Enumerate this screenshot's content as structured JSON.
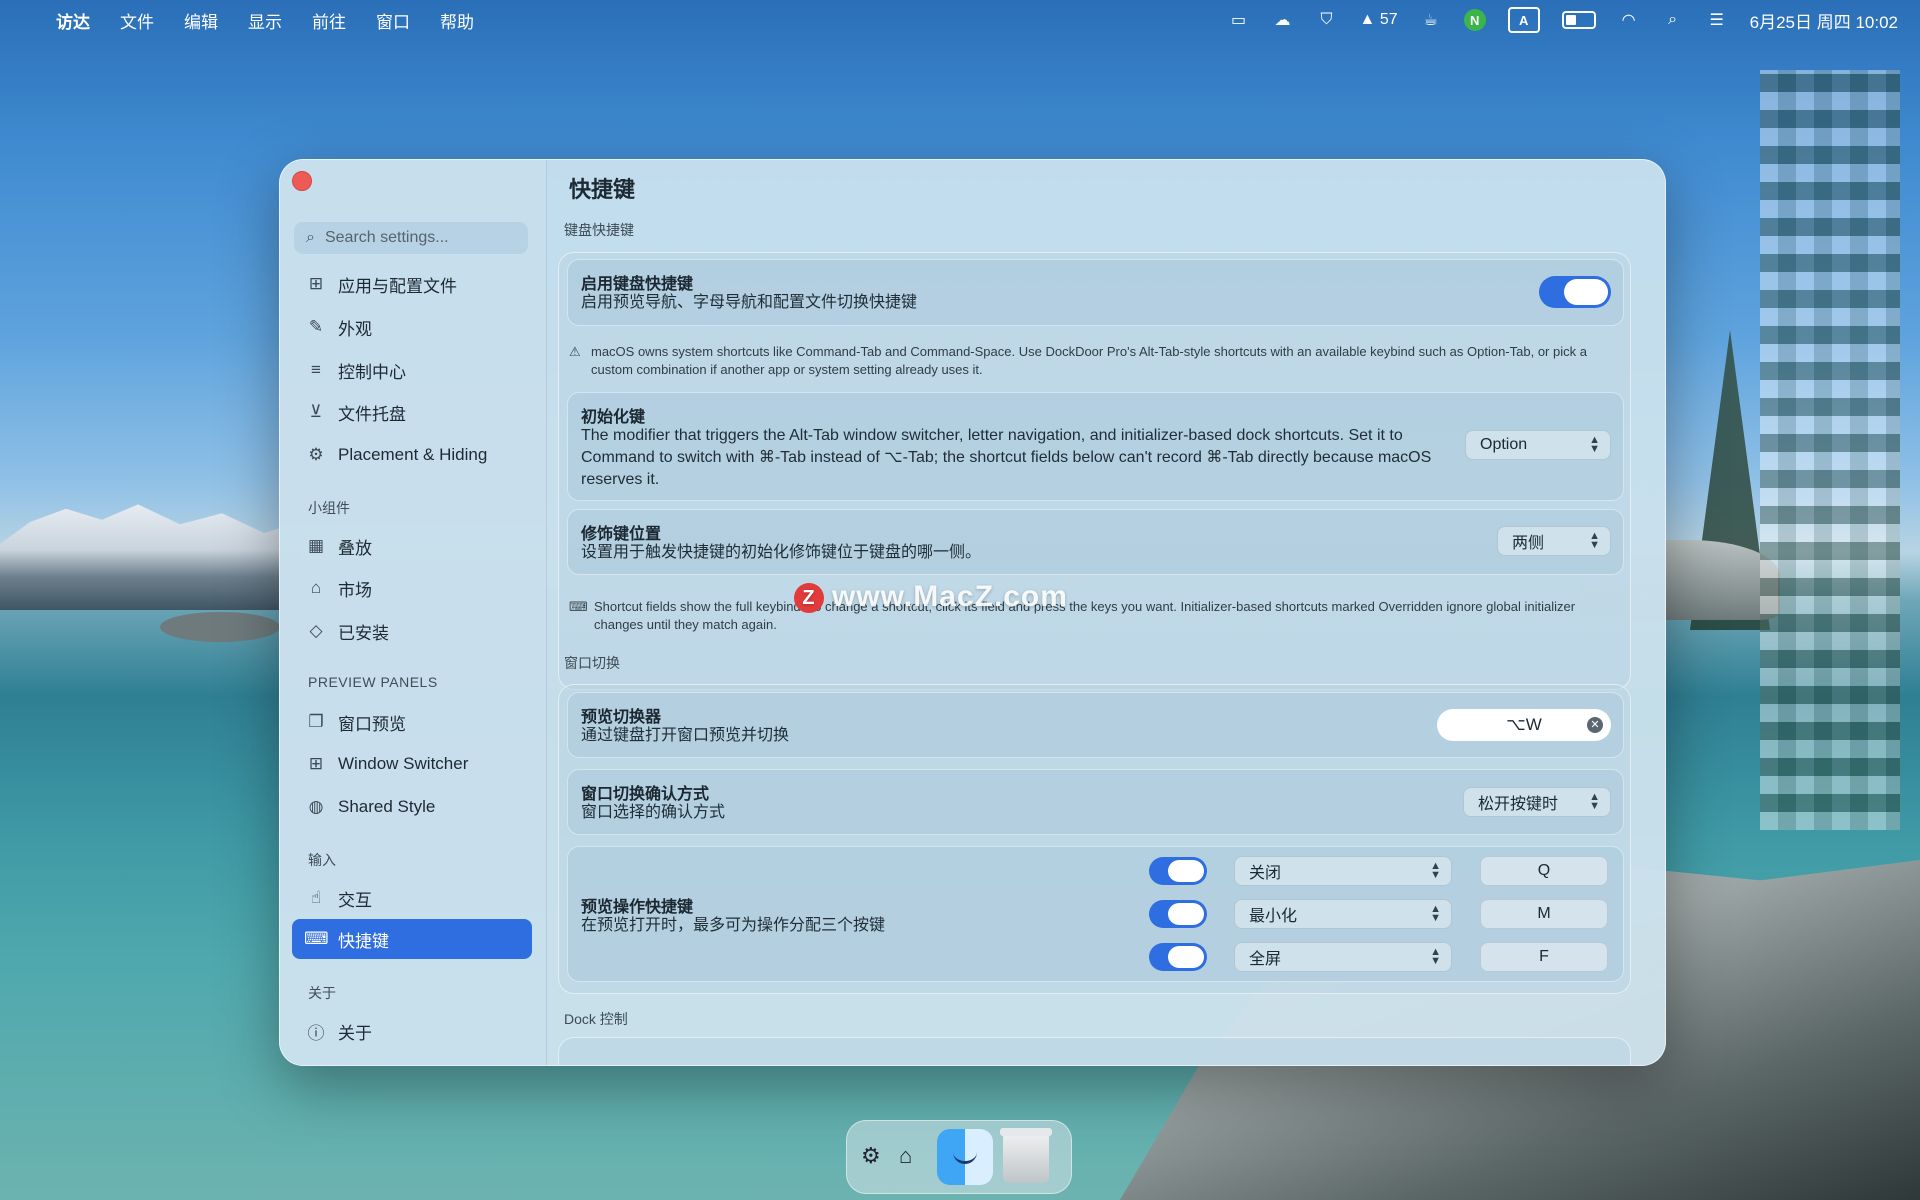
{
  "menubar": {
    "app": "访达",
    "items": [
      "文件",
      "编辑",
      "显示",
      "前往",
      "窗口",
      "帮助"
    ],
    "temp": "57",
    "datetime": "6月25日 周四 10:02",
    "input_indicator": "A"
  },
  "sidebar": {
    "search_placeholder": "Search settings...",
    "items_top": [
      {
        "label": "应用与配置文件",
        "icon": "grid-icon"
      },
      {
        "label": "外观",
        "icon": "brush-icon"
      },
      {
        "label": "控制中心",
        "icon": "sliders-icon"
      },
      {
        "label": "文件托盘",
        "icon": "tray-icon"
      },
      {
        "label": "Placement & Hiding",
        "icon": "gear-icon"
      }
    ],
    "section_widgets": "小组件",
    "items_widgets": [
      {
        "label": "叠放",
        "icon": "apps-icon"
      },
      {
        "label": "市场",
        "icon": "store-icon"
      },
      {
        "label": "已安装",
        "icon": "cube-icon"
      }
    ],
    "section_preview": "PREVIEW PANELS",
    "items_preview": [
      {
        "label": "窗口预览",
        "icon": "windows-icon"
      },
      {
        "label": "Window Switcher",
        "icon": "grid-icon"
      },
      {
        "label": "Shared Style",
        "icon": "palette-icon"
      }
    ],
    "section_input": "输入",
    "items_input": [
      {
        "label": "交互",
        "icon": "hand-icon"
      },
      {
        "label": "快捷键",
        "icon": "keyboard-icon",
        "active": true
      }
    ],
    "section_about": "关于",
    "items_about": [
      {
        "label": "关于",
        "icon": "info-icon"
      }
    ]
  },
  "main": {
    "title": "快捷键",
    "keyboard": {
      "heading": "键盘快捷键",
      "enable_title": "启用键盘快捷键",
      "enable_desc": "启用预览导航、字母导航和配置文件切换快捷键",
      "enable_on": true,
      "warning": "macOS owns system shortcuts like Command-Tab and Command-Space. Use DockDoor Pro's Alt-Tab-style shortcuts with an available keybind such as Option-Tab, or pick a custom combination if another app or system setting already uses it.",
      "init_title": "初始化键",
      "init_desc": "The modifier that triggers the Alt-Tab window switcher, letter navigation, and initializer-based dock shortcuts. Set it to Command to switch with ⌘-Tab instead of ⌥-Tab; the shortcut fields below can't record ⌘-Tab directly because macOS reserves it.",
      "init_value": "Option",
      "side_title": "修饰键位置",
      "side_desc": "设置用于触发快捷键的初始化修饰键位于键盘的哪一侧。",
      "side_value": "两侧",
      "footnote": "Shortcut fields show the full keybind. To change a shortcut, click its field and press the keys you want. Initializer-based shortcuts marked Overridden ignore global initializer changes until they match again."
    },
    "switch": {
      "heading": "窗口切换",
      "switcher_title": "预览切换器",
      "switcher_desc": "通过键盘打开窗口预览并切换",
      "switcher_key": "⌥W",
      "confirm_title": "窗口切换确认方式",
      "confirm_desc": "窗口选择的确认方式",
      "confirm_value": "松开按键时",
      "actions_title": "预览操作快捷键",
      "actions_desc": "在预览打开时，最多可为操作分配三个按键",
      "actions": [
        {
          "enabled": true,
          "action": "关闭",
          "key": "Q"
        },
        {
          "enabled": true,
          "action": "最小化",
          "key": "M"
        },
        {
          "enabled": true,
          "action": "全屏",
          "key": "F"
        }
      ]
    },
    "dock_heading": "Dock 控制"
  },
  "watermark": "www.MacZ.com",
  "colors": {
    "accent": "#2f6ee0",
    "close": "#ee5b56"
  }
}
